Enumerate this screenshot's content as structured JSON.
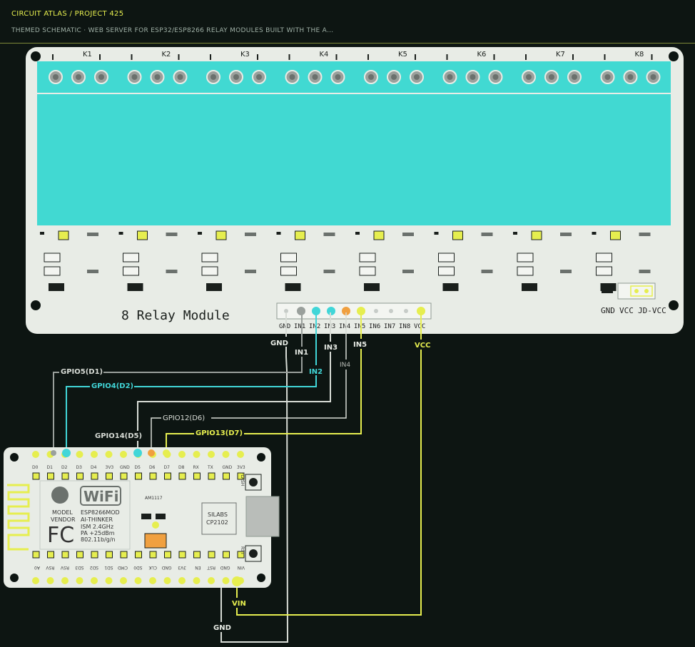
{
  "header": {
    "brand": "CIRCUIT ATLAS / PROJECT 425",
    "subtitle": "THEMED SCHEMATIC · WEB SERVER FOR ESP32/ESP8266 RELAY MODULES BUILT WITH THE A…"
  },
  "relay_module": {
    "title": "8 Relay Module",
    "relays": [
      "K1",
      "K2",
      "K3",
      "K4",
      "K5",
      "K6",
      "K7",
      "K8"
    ],
    "pins": [
      "GND",
      "IN1",
      "IN2",
      "IN3",
      "IN4",
      "IN5",
      "IN6",
      "IN7",
      "IN8",
      "VCC"
    ],
    "power_pins": [
      "GND",
      "VCC",
      "JD-VCC"
    ]
  },
  "net_labels": {
    "gnd_top": "GND",
    "in1": "IN1",
    "in2": "IN2",
    "in3": "IN3",
    "in4": "IN4",
    "in5": "IN5",
    "vcc": "VCC",
    "vin": "VIN",
    "gnd_bottom": "GND"
  },
  "gpio_labels": {
    "gpio5": "GPIO5(D1)",
    "gpio4": "GPIO4(D2)",
    "gpio12": "GPIO12(D6)",
    "gpio14": "GPIO14(D5)",
    "gpio13": "GPIO13(D7)"
  },
  "esp_board": {
    "top_pins": [
      "D0",
      "D1",
      "D2",
      "D3",
      "D4",
      "3V3",
      "GND",
      "D5",
      "D6",
      "D7",
      "D8",
      "RX",
      "TX",
      "GND",
      "3V3"
    ],
    "bottom_pins": [
      "A0",
      "RSV",
      "RSV",
      "SD3",
      "SD2",
      "SD1",
      "CMD",
      "SD0",
      "CLK",
      "GND",
      "3V3",
      "EN",
      "RST",
      "GND",
      "VIN"
    ],
    "wifi_logo": "WiFi",
    "module_text": [
      "ESP8266MOD",
      "AI-THINKER",
      "ISM 2.4GHz",
      "PA +25dBm",
      "802.11b/g/n"
    ],
    "model_text": [
      "MODEL",
      "VENDOR"
    ],
    "fcc": "FC",
    "usb_chip": [
      "SILABS",
      "CP2102"
    ],
    "regulator": "AM1117",
    "flash_label": "FLASH",
    "rst_label": "RST"
  },
  "colors": {
    "accent": "#e6ee4f",
    "board": "#e8ece6",
    "relay_body": "#41d9d2",
    "wire_white": "#d8dcd6",
    "wire_cyan": "#41d6d8",
    "wire_yellow": "#e6ee4f",
    "wire_gray": "#9aa09c",
    "wire_orange": "#f0a040"
  }
}
